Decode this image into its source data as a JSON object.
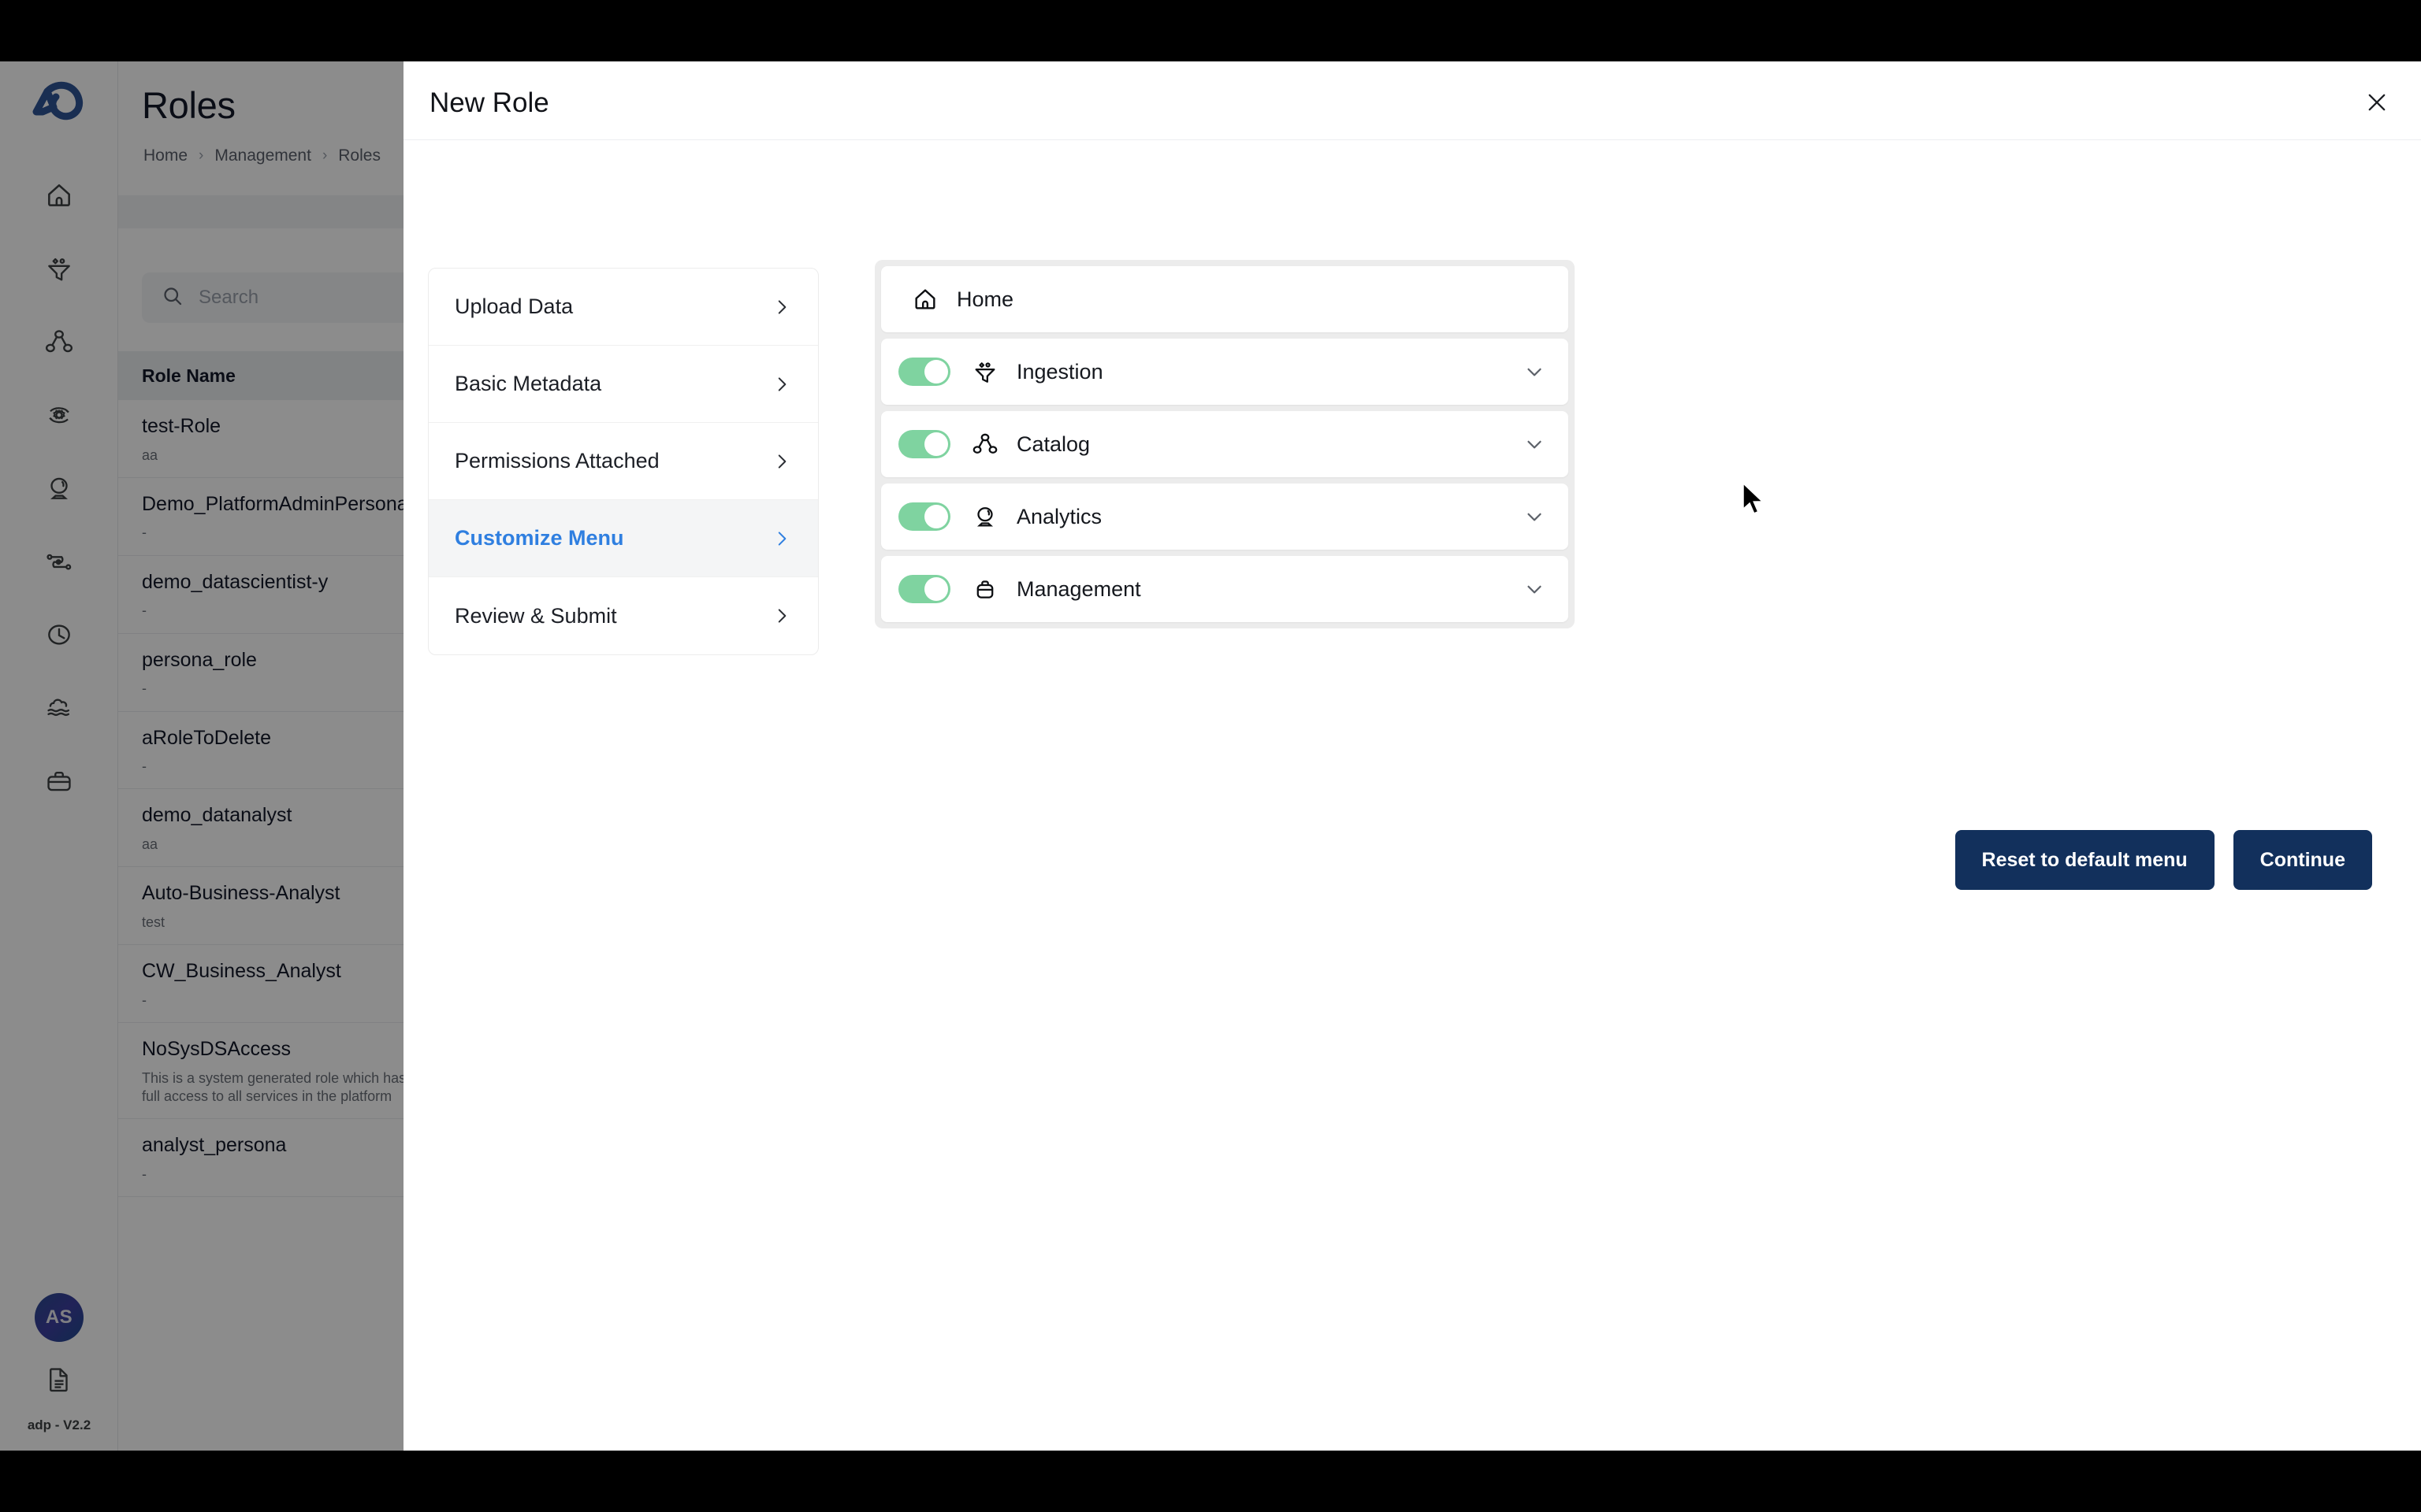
{
  "app": {
    "logo_icon": "brand-logo-icon",
    "page_title": "Roles",
    "breadcrumb": [
      "Home",
      "Management",
      "Roles"
    ],
    "search_placeholder": "Search",
    "table_header": "Role Name",
    "rail_icons": [
      "home-icon",
      "ingestion-funnel-icon",
      "catalog-network-icon",
      "settings-gear-icon",
      "analytics-crystalball-icon",
      "pipeline-icon",
      "history-clock-icon",
      "data-lake-icon",
      "management-briefcase-icon"
    ],
    "avatar_initials": "AS",
    "doc_icon": "document-icon",
    "version_label": "adp - V2.2",
    "roles": [
      {
        "name": "test-Role",
        "desc": "aa"
      },
      {
        "name": "Demo_PlatformAdminPersona",
        "desc": "-"
      },
      {
        "name": "demo_datascientist-y",
        "desc": "-"
      },
      {
        "name": "persona_role",
        "desc": "-"
      },
      {
        "name": "aRoleToDelete",
        "desc": "-"
      },
      {
        "name": "demo_datanalyst",
        "desc": "aa"
      },
      {
        "name": "Auto-Business-Analyst",
        "desc": "test"
      },
      {
        "name": "CW_Business_Analyst",
        "desc": "-"
      },
      {
        "name": "NoSysDSAccess",
        "desc": "This is a system generated role which has full access to all services in the platform"
      },
      {
        "name": "analyst_persona",
        "desc": "-"
      }
    ]
  },
  "modal": {
    "title": "New Role",
    "close_icon": "close-icon",
    "steps": [
      {
        "label": "Upload Data",
        "active": false
      },
      {
        "label": "Basic Metadata",
        "active": false
      },
      {
        "label": "Permissions Attached",
        "active": false
      },
      {
        "label": "Customize Menu",
        "active": true
      },
      {
        "label": "Review & Submit",
        "active": false
      }
    ],
    "menu_items": [
      {
        "label": "Home",
        "icon": "home-icon",
        "has_toggle": false,
        "toggle_on": false,
        "expandable": false
      },
      {
        "label": "Ingestion",
        "icon": "ingestion-funnel-icon",
        "has_toggle": true,
        "toggle_on": true,
        "expandable": true
      },
      {
        "label": "Catalog",
        "icon": "catalog-network-icon",
        "has_toggle": true,
        "toggle_on": true,
        "expandable": true
      },
      {
        "label": "Analytics",
        "icon": "analytics-crystalball-icon",
        "has_toggle": true,
        "toggle_on": true,
        "expandable": true
      },
      {
        "label": "Management",
        "icon": "management-briefcase-icon",
        "has_toggle": true,
        "toggle_on": true,
        "expandable": true
      }
    ],
    "reset_label": "Reset to default menu",
    "continue_label": "Continue"
  },
  "colors": {
    "accent_blue": "#2f7fe0",
    "button_navy": "#12305c",
    "toggle_green": "#7fd3a0",
    "brand_blue": "#2f5496"
  }
}
